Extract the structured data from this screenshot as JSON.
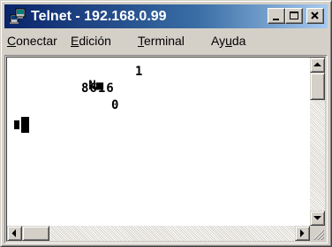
{
  "window": {
    "title": "Telnet - 192.168.0.99",
    "icon": "telnet-computer-icon",
    "caption_buttons": [
      "minimize-icon",
      "maximize-icon",
      "close-icon"
    ]
  },
  "menu": {
    "items": [
      {
        "label": "Conectar",
        "mnemonic": "C"
      },
      {
        "label": "Edición",
        "mnemonic": "E"
      },
      {
        "label": "Terminal",
        "mnemonic": "T"
      },
      {
        "label": "Ayuda",
        "mnemonic": "u"
      }
    ]
  },
  "terminal": {
    "lines": [
      {
        "text": "N",
        "cursor_after": "■",
        "value": "1"
      },
      {
        "text": "8616"
      },
      {
        "text": "0"
      },
      {
        "text": "",
        "cursor": "block"
      }
    ]
  },
  "colors": {
    "title_start": "#0a246a",
    "title_end": "#a6caf0",
    "face": "#d4d0c8",
    "terminal_bg": "#ffffff",
    "terminal_fg": "#000000"
  }
}
